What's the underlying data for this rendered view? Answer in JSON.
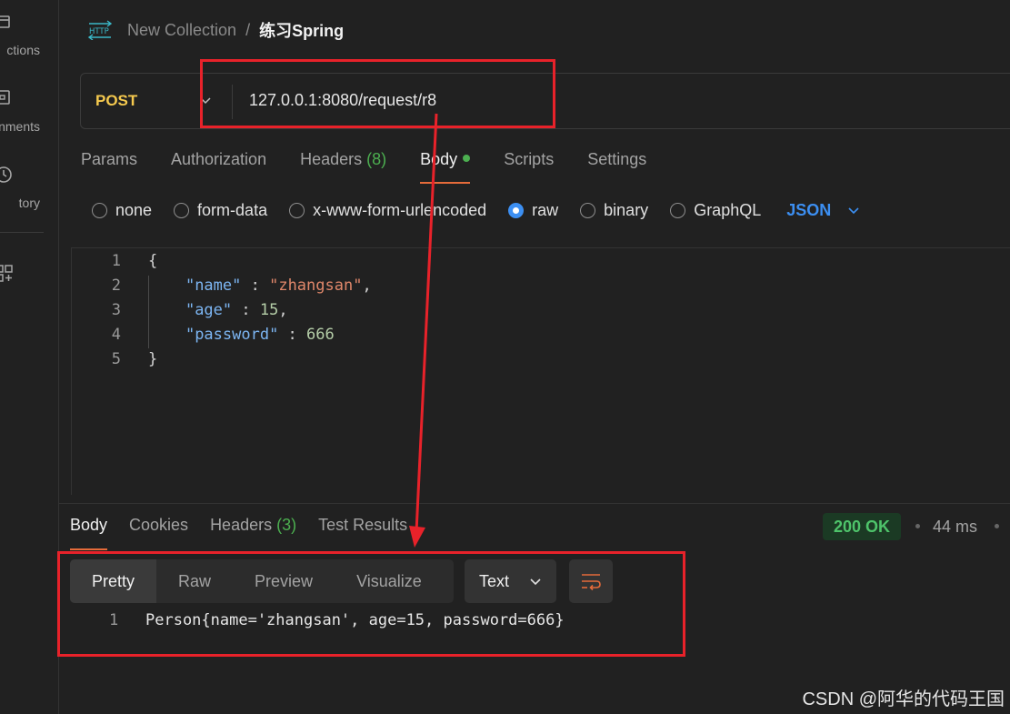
{
  "sidebar": {
    "items": [
      {
        "label": "ctions",
        "icon": "collections-icon"
      },
      {
        "label": "nments",
        "icon": "environments-icon"
      },
      {
        "label": "tory",
        "icon": "history-icon"
      },
      {
        "label": "",
        "icon": "apps-icon"
      }
    ]
  },
  "header": {
    "collection": "New Collection",
    "separator": "/",
    "request_name": "练习Spring"
  },
  "request": {
    "method": "POST",
    "url": "127.0.0.1:8080/request/r8",
    "tabs": [
      {
        "label": "Params"
      },
      {
        "label": "Authorization"
      },
      {
        "label": "Headers",
        "count": "(8)"
      },
      {
        "label": "Body"
      },
      {
        "label": "Scripts"
      },
      {
        "label": "Settings"
      }
    ],
    "body_types": [
      "none",
      "form-data",
      "x-www-form-urlencoded",
      "raw",
      "binary",
      "GraphQL"
    ],
    "selected_body_type": "raw",
    "language": "JSON"
  },
  "editor": {
    "lines": [
      {
        "n": "1",
        "text": "{"
      },
      {
        "n": "2",
        "key": "\"name\"",
        "sep": " : ",
        "value": "\"zhangsan\"",
        "tail": ","
      },
      {
        "n": "3",
        "key": "\"age\"",
        "sep": " : ",
        "value": "15",
        "tail": ","
      },
      {
        "n": "4",
        "key": "\"password\"",
        "sep": " : ",
        "value": "666",
        "tail": ""
      },
      {
        "n": "5",
        "text": "}"
      }
    ]
  },
  "response": {
    "tabs": [
      {
        "label": "Body"
      },
      {
        "label": "Cookies"
      },
      {
        "label": "Headers",
        "count": "(3)"
      },
      {
        "label": "Test Results"
      }
    ],
    "status": "200 OK",
    "time": "44 ms",
    "view_modes": [
      "Pretty",
      "Raw",
      "Preview",
      "Visualize"
    ],
    "format": "Text",
    "line_number": "1",
    "body": "Person{name='zhangsan', age=15, password=666}"
  },
  "watermark": "CSDN @阿华的代码王国",
  "colors": {
    "method": "#f5c94e",
    "accent": "#e56b3a",
    "link": "#3c8ff2",
    "success": "#4ec36a",
    "annotation": "#e8222a"
  }
}
